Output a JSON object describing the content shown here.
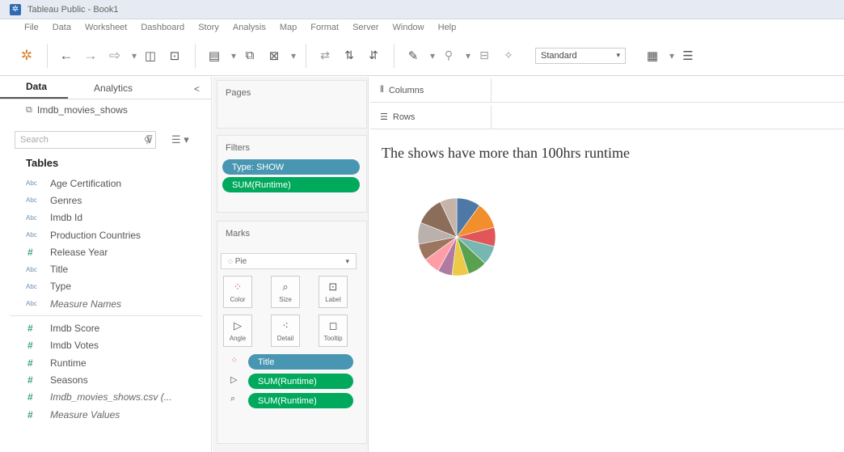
{
  "window": {
    "title": "Tableau Public - Book1"
  },
  "menu": [
    "File",
    "Data",
    "Worksheet",
    "Dashboard",
    "Story",
    "Analysis",
    "Map",
    "Format",
    "Server",
    "Window",
    "Help"
  ],
  "toolbar": {
    "fit_select": "Standard"
  },
  "left_panel": {
    "tab_data": "Data",
    "tab_analytics": "Analytics",
    "collapse": "<",
    "datasource": "Imdb_movies_shows",
    "search_placeholder": "Search",
    "tables_heading": "Tables",
    "dimensions": [
      {
        "type": "Abc",
        "name": "Age Certification"
      },
      {
        "type": "Abc",
        "name": "Genres"
      },
      {
        "type": "Abc",
        "name": "Imdb Id"
      },
      {
        "type": "Abc",
        "name": "Production Countries"
      },
      {
        "type": "#",
        "name": "Release Year"
      },
      {
        "type": "Abc",
        "name": "Title"
      },
      {
        "type": "Abc",
        "name": "Type"
      },
      {
        "type": "Abc",
        "name": "Measure Names"
      }
    ],
    "measures": [
      {
        "type": "#",
        "name": "Imdb Score"
      },
      {
        "type": "#",
        "name": "Imdb Votes"
      },
      {
        "type": "#",
        "name": "Runtime"
      },
      {
        "type": "#",
        "name": "Seasons"
      },
      {
        "type": "#",
        "name": "Imdb_movies_shows.csv (..."
      },
      {
        "type": "#",
        "name": "Measure Values"
      }
    ]
  },
  "shelves": {
    "pages_title": "Pages",
    "filters_title": "Filters",
    "filters": [
      "Type: SHOW",
      "SUM(Runtime)"
    ],
    "marks_title": "Marks",
    "mark_type": "Pie",
    "mark_buttons": [
      "Color",
      "Size",
      "Label",
      "Angle",
      "Detail",
      "Tooltip"
    ],
    "mark_pills": [
      "Title",
      "SUM(Runtime)",
      "SUM(Runtime)"
    ]
  },
  "view": {
    "columns_label": "Columns",
    "rows_label": "Rows",
    "sheet_title": "The shows have more than 100hrs runtime"
  },
  "chart_data": {
    "type": "pie",
    "values": [
      10,
      11,
      8,
      8,
      8,
      7,
      6,
      7,
      7,
      9,
      12,
      7
    ],
    "colors": [
      "#4e79a7",
      "#f28e2b",
      "#e15759",
      "#76b7b2",
      "#59a14f",
      "#edc948",
      "#b07aa1",
      "#ff9da7",
      "#9c755f",
      "#bab0ac",
      "#8c6d59",
      "#c6b4a8"
    ]
  }
}
